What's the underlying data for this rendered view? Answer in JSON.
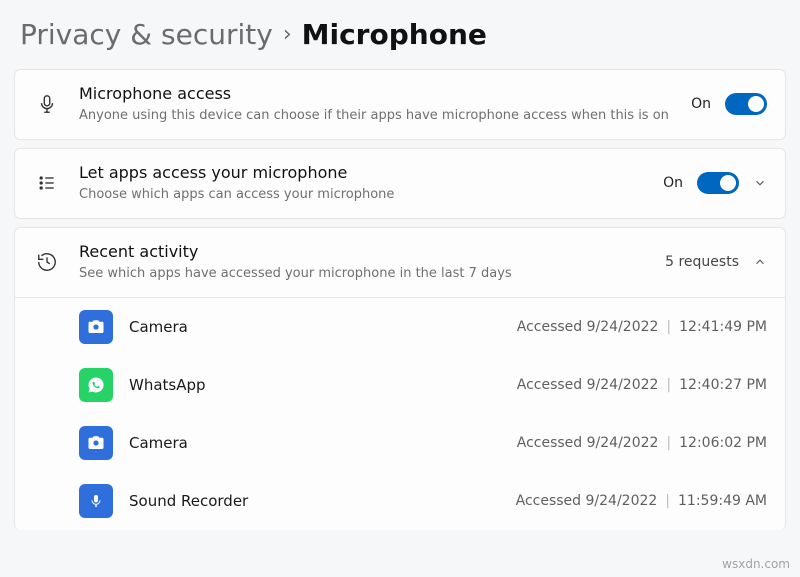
{
  "breadcrumb": {
    "parent": "Privacy & security",
    "separator": "›",
    "current": "Microphone"
  },
  "sections": {
    "mic_access": {
      "title": "Microphone access",
      "subtitle": "Anyone using this device can choose if their apps have microphone access when this is on",
      "state": "On"
    },
    "let_apps": {
      "title": "Let apps access your microphone",
      "subtitle": "Choose which apps can access your microphone",
      "state": "On"
    },
    "recent": {
      "title": "Recent activity",
      "subtitle": "See which apps have accessed your microphone in the last 7 days",
      "count_label": "5 requests"
    }
  },
  "activity": [
    {
      "app": "Camera",
      "icon": "camera",
      "accessed_label": "Accessed 9/24/2022",
      "time": "12:41:49 PM"
    },
    {
      "app": "WhatsApp",
      "icon": "whatsapp",
      "accessed_label": "Accessed 9/24/2022",
      "time": "12:40:27 PM"
    },
    {
      "app": "Camera",
      "icon": "camera",
      "accessed_label": "Accessed 9/24/2022",
      "time": "12:06:02 PM"
    },
    {
      "app": "Sound Recorder",
      "icon": "recorder",
      "accessed_label": "Accessed 9/24/2022",
      "time": "11:59:49 AM"
    }
  ],
  "watermark": "wsxdn.com"
}
